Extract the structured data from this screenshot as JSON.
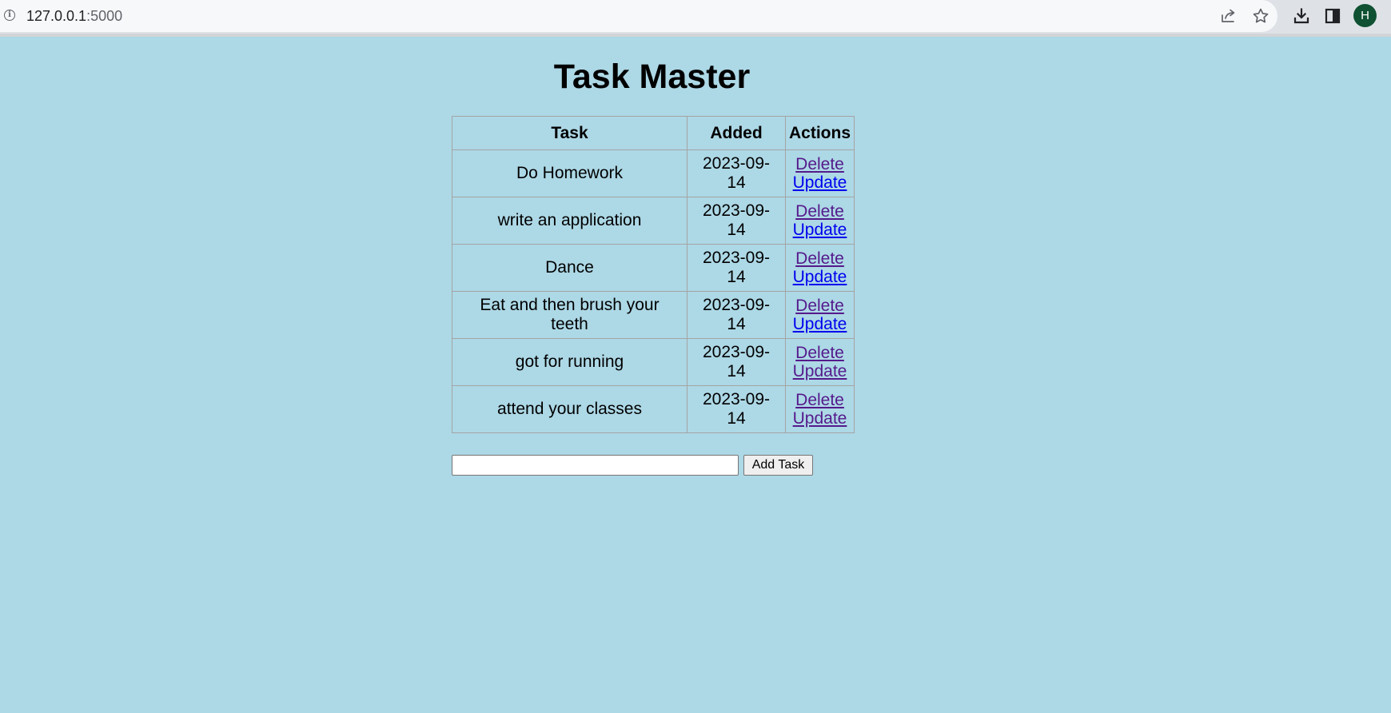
{
  "browser": {
    "url_host": "127.0.0.1",
    "url_port": ":5000",
    "toolbar_icons": [
      "share-icon",
      "star-icon",
      "download-icon",
      "side-panel-icon"
    ],
    "profile_initial": "H",
    "profile_color": "#0f5132"
  },
  "page": {
    "background_color": "#add8e6",
    "title": "Task Master"
  },
  "table": {
    "headers": {
      "task": "Task",
      "added": "Added",
      "actions": "Actions"
    },
    "rows": [
      {
        "task": "Do Homework",
        "added": "2023-09-14",
        "delete": "Delete",
        "update": "Update"
      },
      {
        "task": "write an application",
        "added": "2023-09-14",
        "delete": "Delete",
        "update": "Update"
      },
      {
        "task": "Dance",
        "added": "2023-09-14",
        "delete": "Delete",
        "update": "Update"
      },
      {
        "task": "Eat and then brush your teeth",
        "added": "2023-09-14",
        "delete": "Delete",
        "update": "Update"
      },
      {
        "task": "got for running",
        "added": "2023-09-14",
        "delete": "Delete",
        "update": "Update"
      },
      {
        "task": "attend your classes",
        "added": "2023-09-14",
        "delete": "Delete",
        "update": "Update"
      }
    ],
    "link_colors": {
      "visited": "#551a8b",
      "unvisited": "#0000ee"
    }
  },
  "form": {
    "input_value": "",
    "submit_label": "Add Task"
  }
}
